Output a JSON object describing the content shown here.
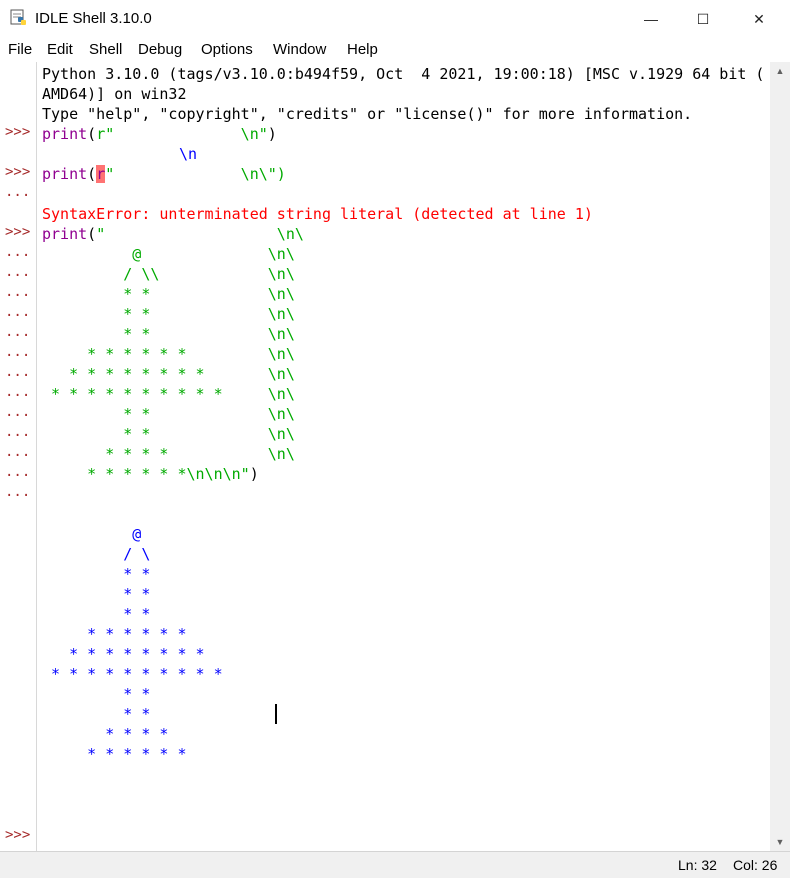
{
  "window": {
    "title": "IDLE Shell 3.10.0",
    "icon": "idle-python-icon"
  },
  "window_controls": {
    "minimize": "—",
    "maximize": "☐",
    "close": "✕"
  },
  "menu": [
    "File",
    "Edit",
    "Shell",
    "Debug",
    "Options",
    "Window",
    "Help"
  ],
  "gutter_prompts": {
    "main": ">>>",
    "cont": "..."
  },
  "banner": {
    "l1": "Python 3.10.0 (tags/v3.10.0:b494f59, Oct  4 2021, 19:00:18) [MSC v.1929 64 bit (",
    "l2": "AMD64)] on win32",
    "l3": "Type \"help\", \"copyright\", \"credits\" or \"license()\" for more information."
  },
  "session": {
    "cmd1_print": "print",
    "cmd1_paren": "(",
    "cmd1_str": "r\"              \\n\"",
    "cmd1_close": ")",
    "out1": "\\n",
    "cmd2_print": "print",
    "cmd2_paren": "(",
    "cmd2_r": "r",
    "cmd2_str": "\"              \\n\\\")",
    "error": "SyntaxError: unterminated string literal (detected at line 1)",
    "cmd3_print": "print",
    "cmd3_paren": "(",
    "cmd3_lines": [
      "\"                   \\n\\",
      "          @              \\n\\",
      "         / \\\\            \\n\\",
      "         * *             \\n\\",
      "         * *             \\n\\",
      "         * *             \\n\\",
      "     * * * * * *         \\n\\",
      "   * * * * * * * *       \\n\\",
      " * * * * * * * * * *     \\n\\",
      "         * *             \\n\\",
      "         * *             \\n\\",
      "       * * * *           \\n\\",
      "     * * * * * *\\n\\n\\n\""
    ],
    "cmd3_close": ")",
    "output_tree": [
      "          @",
      "         / \\",
      "         * *",
      "         * *",
      "         * *",
      "     * * * * * *",
      "   * * * * * * * *",
      " * * * * * * * * * *",
      "         * *",
      "         * *",
      "       * * * *",
      "     * * * * * *"
    ]
  },
  "status": {
    "line": "Ln: 32",
    "col": "Col: 26"
  }
}
